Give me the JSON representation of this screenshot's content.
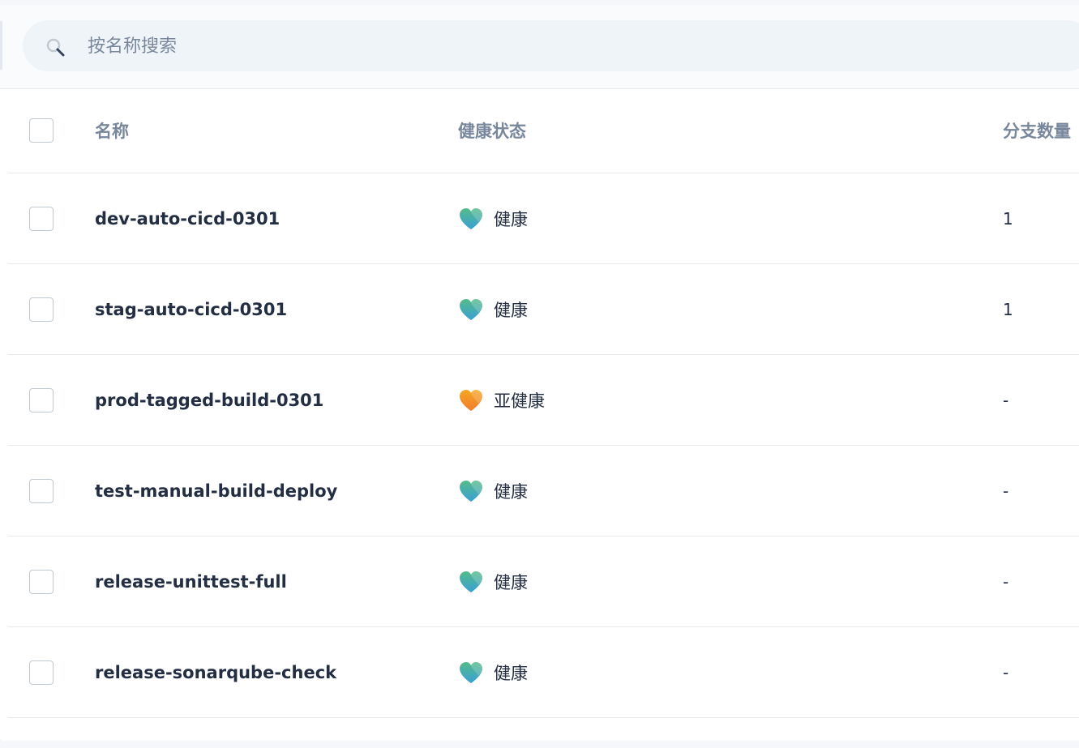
{
  "search": {
    "placeholder": "按名称搜索",
    "value": ""
  },
  "table": {
    "columns": {
      "name": "名称",
      "health": "健康状态",
      "branches": "分支数量"
    },
    "rows": [
      {
        "name": "dev-auto-cicd-0301",
        "health": "健康",
        "health_level": "healthy",
        "branches": "1"
      },
      {
        "name": "stag-auto-cicd-0301",
        "health": "健康",
        "health_level": "healthy",
        "branches": "1"
      },
      {
        "name": "prod-tagged-build-0301",
        "health": "亚健康",
        "health_level": "sub-healthy",
        "branches": "-"
      },
      {
        "name": "test-manual-build-deploy",
        "health": "健康",
        "health_level": "healthy",
        "branches": "-"
      },
      {
        "name": "release-unittest-full",
        "health": "健康",
        "health_level": "healthy",
        "branches": "-"
      },
      {
        "name": "release-sonarqube-check",
        "health": "健康",
        "health_level": "healthy",
        "branches": "-"
      }
    ]
  },
  "colors": {
    "healthy_heart_top": "#55bc8a",
    "healthy_heart_bottom": "#3a9fd6",
    "subhealthy_heart_top": "#f5a623",
    "subhealthy_heart_bottom": "#f07d2c"
  }
}
